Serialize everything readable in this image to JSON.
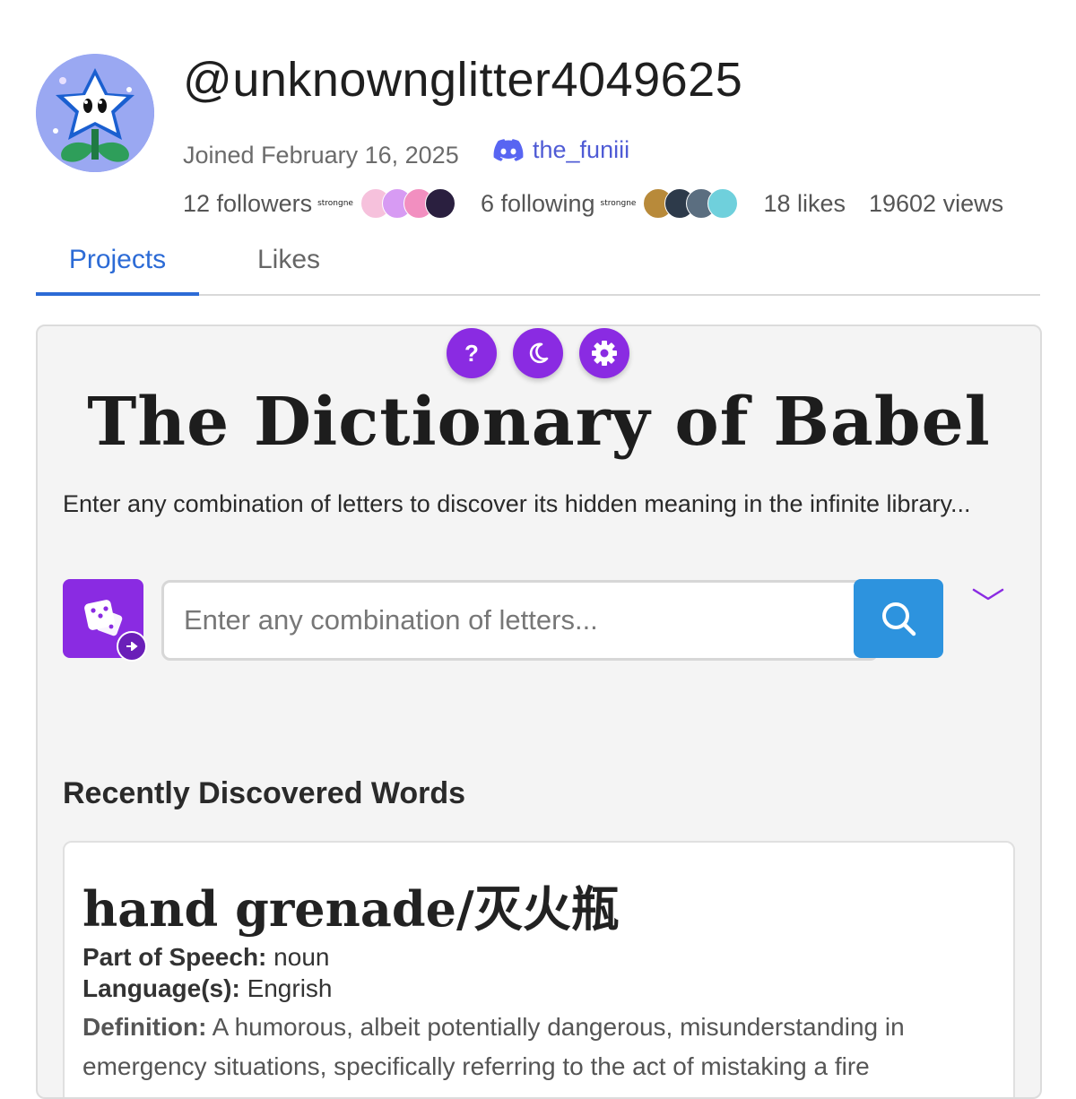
{
  "profile": {
    "username": "@unknownglitter4049625",
    "joined": "Joined February 16, 2025",
    "discord": "the_funiii",
    "followers": "12 followers",
    "following": "6 following",
    "likes": "18 likes",
    "views": "19602 views",
    "strong_tag": "strongne"
  },
  "tabs": [
    {
      "label": "Projects",
      "active": true
    },
    {
      "label": "Likes",
      "active": false
    }
  ],
  "project": {
    "title": "The Dictionary of Babel",
    "intro": "Enter any combination of letters to discover its hidden meaning in the infinite library...",
    "search_placeholder": "Enter any combination of letters...",
    "recent_heading": "Recently Discovered Words",
    "word": {
      "title": "hand grenade/灭火瓶",
      "pos_label": "Part of Speech:",
      "pos_value": "noun",
      "lang_label": "Language(s):",
      "lang_value": "Engrish",
      "def_label": "Definition:",
      "def_value": "A humorous, albeit potentially dangerous, misunderstanding in emergency situations, specifically referring to the act of mistaking a fire"
    }
  },
  "colors": {
    "accent_purple": "#8a2be2",
    "search_blue": "#2d93de",
    "tab_blue": "#2c6bd6",
    "discord_blue": "#4f5bd5"
  },
  "icons": [
    "help-icon",
    "moon-icon",
    "gear-icon",
    "dice-icon",
    "search-icon",
    "chevron-down-icon",
    "discord-icon"
  ]
}
